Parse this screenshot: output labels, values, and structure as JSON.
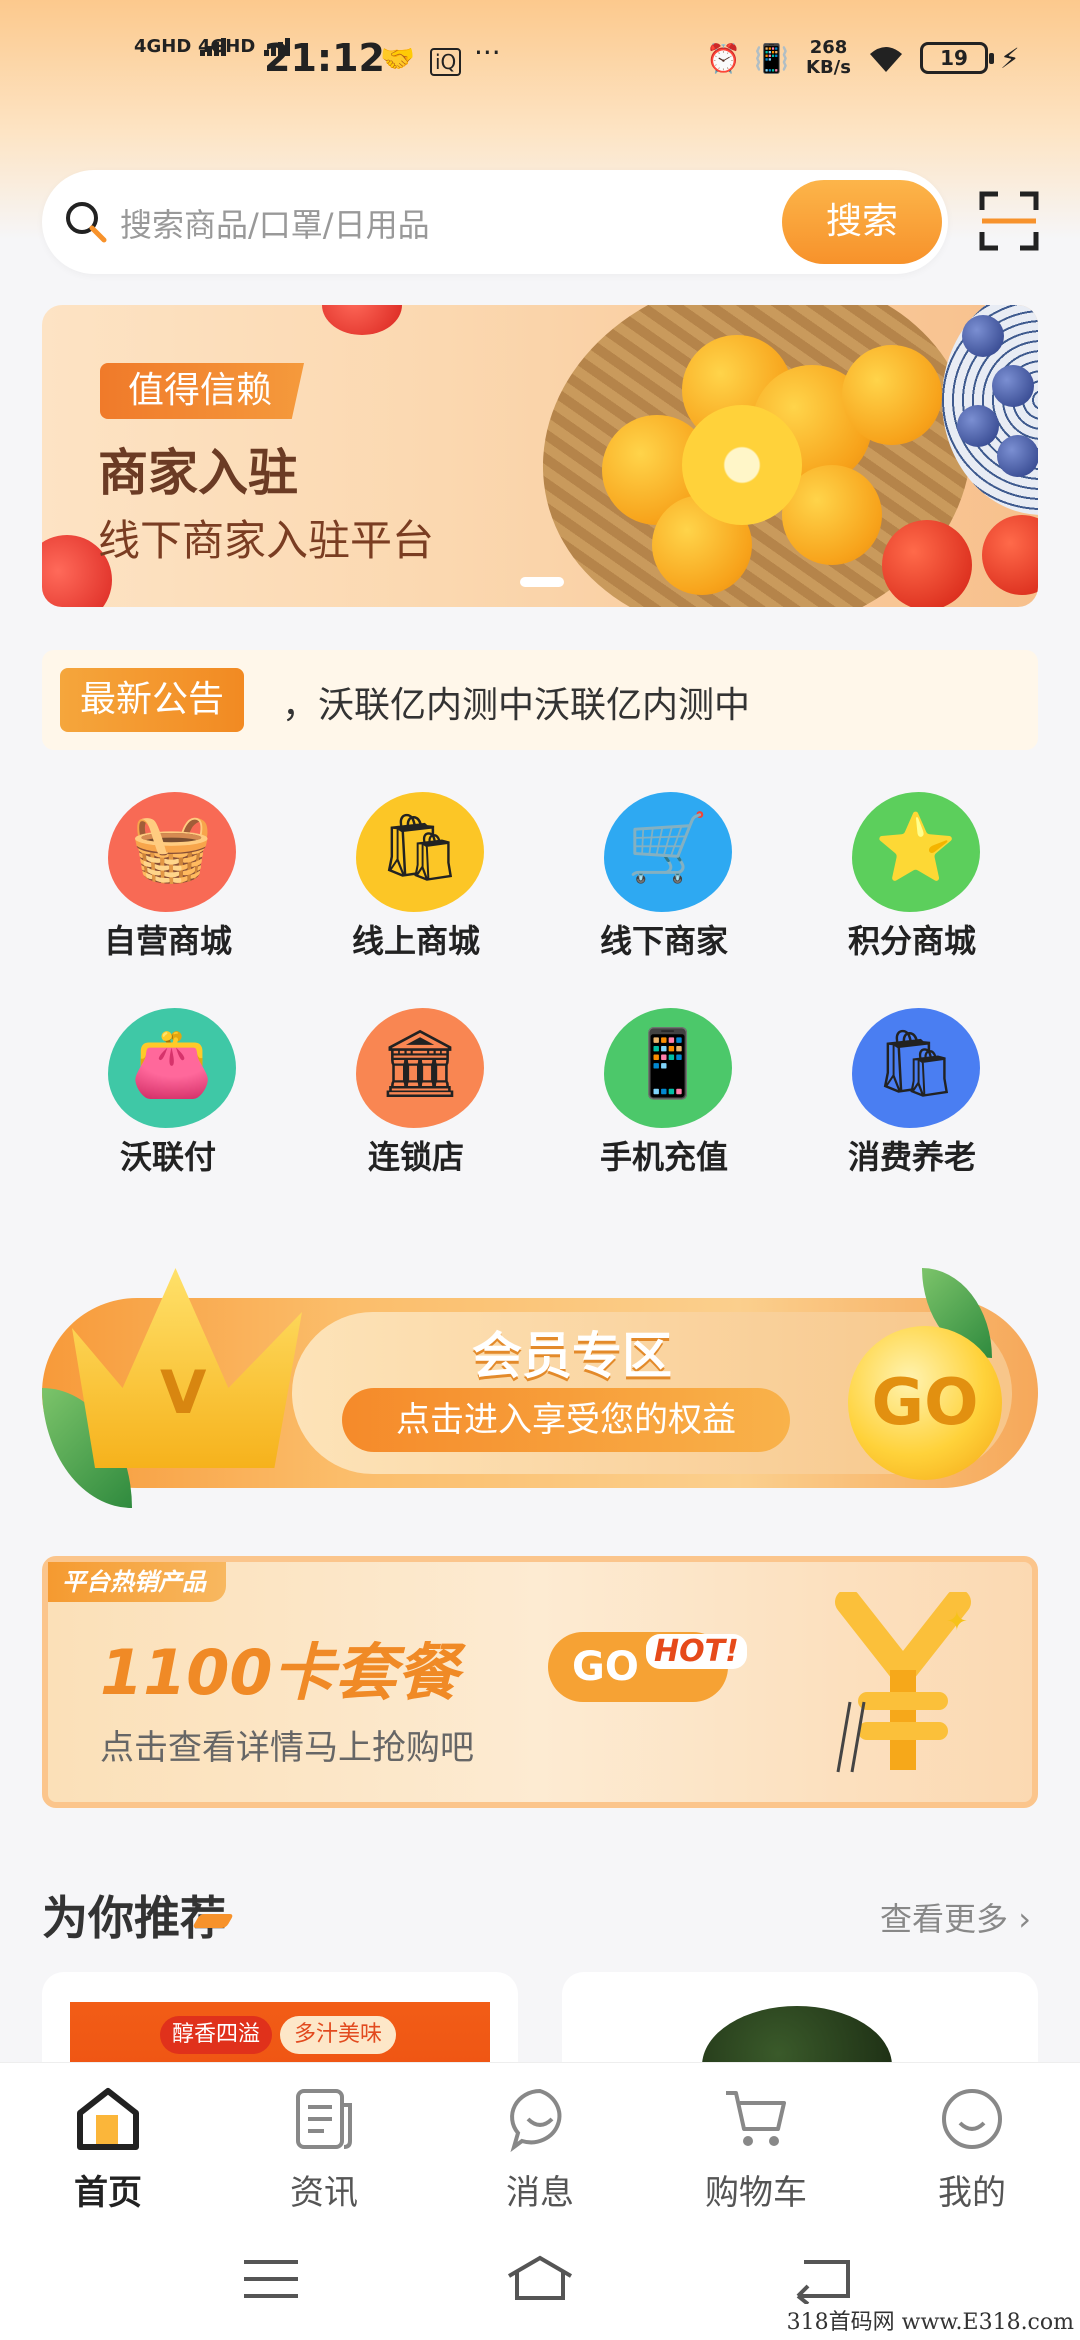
{
  "status_bar": {
    "net1": "4GHD",
    "net2": "4GHD",
    "time": "21:12",
    "speed_value": "268",
    "speed_unit": "KB/s",
    "battery": "19"
  },
  "search": {
    "placeholder": "搜索商品/口罩/日用品",
    "button_label": "搜索"
  },
  "banner": {
    "tag": "值得信赖",
    "title": "商家入驻",
    "subtitle": "线下商家入驻平台"
  },
  "notice": {
    "tag": "最新公告",
    "text": "，沃联亿内测中沃联亿内测中"
  },
  "categories": [
    {
      "label": "自营商城",
      "icon": "basket-icon",
      "color": "#f86a55"
    },
    {
      "label": "线上商城",
      "icon": "shopping-basket-icon",
      "color": "#fcc626"
    },
    {
      "label": "线下商家",
      "icon": "cart-icon",
      "color": "#2ea9f2"
    },
    {
      "label": "积分商城",
      "icon": "star-bag-icon",
      "color": "#5ccf5c"
    },
    {
      "label": "沃联付",
      "icon": "wallet-icon",
      "color": "#3fc8a6"
    },
    {
      "label": "连锁店",
      "icon": "store-icon",
      "color": "#f98652"
    },
    {
      "label": "手机充值",
      "icon": "phone-icon",
      "color": "#4cc86a"
    },
    {
      "label": "消费养老",
      "icon": "shopping-bag-icon",
      "color": "#4a7ef2"
    }
  ],
  "member": {
    "title": "会员专区",
    "subtitle": "点击进入享受您的权益",
    "go": "GO",
    "crown_letter": "V"
  },
  "hot": {
    "tag": "平台热销产品",
    "title": "1100卡套餐",
    "go": "GO",
    "hot_label": "HOT!",
    "subtitle": "点击查看详情马上抢购吧"
  },
  "recommend": {
    "title": "为你推荐",
    "more": "查看更多",
    "card1_badge1": "醇香四溢",
    "card1_badge2": "多汁美味"
  },
  "nav": [
    {
      "label": "首页",
      "icon": "home-icon"
    },
    {
      "label": "资讯",
      "icon": "news-icon"
    },
    {
      "label": "消息",
      "icon": "message-icon"
    },
    {
      "label": "购物车",
      "icon": "cart-icon"
    },
    {
      "label": "我的",
      "icon": "profile-icon"
    }
  ],
  "watermark": "318首码网 www.E318.com"
}
